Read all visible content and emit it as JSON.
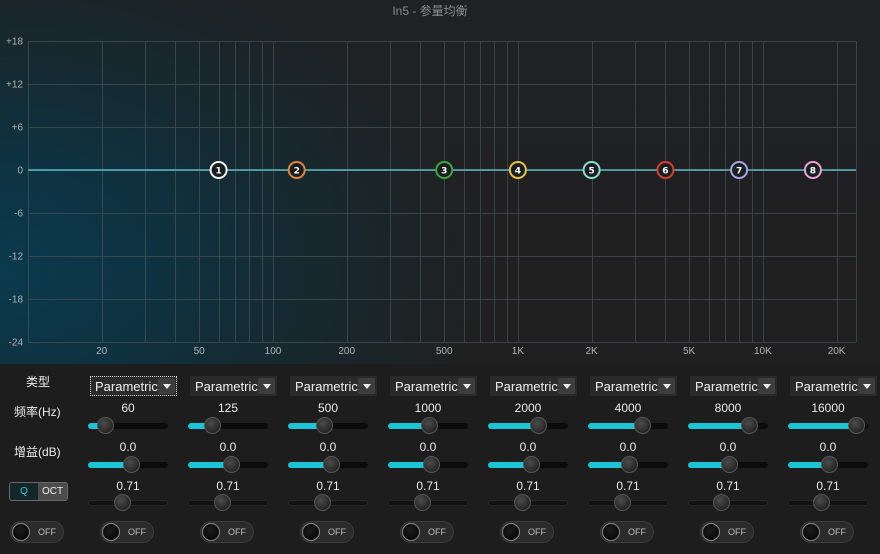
{
  "window": {
    "title": "In5 - 参量均衡"
  },
  "theme": {
    "background": "#1d1d1d",
    "accent": "#1bc5d5",
    "curve": "#5cb8c4",
    "node_fill": "#1a1e20"
  },
  "chart_data": {
    "type": "line",
    "x_scale": "log",
    "xlim": [
      10,
      24000
    ],
    "ylim": [
      -24,
      18
    ],
    "grid": true,
    "x_ticks": [
      {
        "value": 20,
        "label": "20"
      },
      {
        "value": 50,
        "label": "50"
      },
      {
        "value": 100,
        "label": "100"
      },
      {
        "value": 200,
        "label": "200"
      },
      {
        "value": 500,
        "label": "500"
      },
      {
        "value": 1000,
        "label": "1K"
      },
      {
        "value": 2000,
        "label": "2K"
      },
      {
        "value": 5000,
        "label": "5K"
      },
      {
        "value": 10000,
        "label": "10K"
      },
      {
        "value": 20000,
        "label": "20K"
      }
    ],
    "y_ticks": [
      {
        "value": 18,
        "label": "+18"
      },
      {
        "value": 12,
        "label": "+12"
      },
      {
        "value": 6,
        "label": "+6"
      },
      {
        "value": 0,
        "label": "0"
      },
      {
        "value": -6,
        "label": "-6"
      },
      {
        "value": -12,
        "label": "-12"
      },
      {
        "value": -18,
        "label": "-18"
      },
      {
        "value": -24,
        "label": "-24"
      }
    ],
    "series": [
      {
        "x": [
          10,
          24000
        ],
        "y": [
          0,
          0
        ]
      }
    ],
    "points": [
      {
        "label": "1",
        "x": 60,
        "y": 0,
        "color": "#f2f2f2"
      },
      {
        "label": "2",
        "x": 125,
        "y": 0,
        "color": "#e0873a"
      },
      {
        "label": "3",
        "x": 500,
        "y": 0,
        "color": "#3aa83a"
      },
      {
        "label": "4",
        "x": 1000,
        "y": 0,
        "color": "#e8c43c"
      },
      {
        "label": "5",
        "x": 2000,
        "y": 0,
        "color": "#8fe0c8"
      },
      {
        "label": "6",
        "x": 4000,
        "y": 0,
        "color": "#d8402c"
      },
      {
        "label": "7",
        "x": 8000,
        "y": 0,
        "color": "#a6a6e0"
      },
      {
        "label": "8",
        "x": 16000,
        "y": 0,
        "color": "#e8a2d4"
      }
    ]
  },
  "labels": {
    "type": "类型",
    "frequency": "频率(Hz)",
    "gain": "增益(dB)"
  },
  "mode_toggle": {
    "options": [
      {
        "label": "Q",
        "selected": true
      },
      {
        "label": "OCT",
        "selected": false
      }
    ]
  },
  "master_switch": {
    "label": "OFF",
    "on": false
  },
  "bands": [
    {
      "type": "Parametric",
      "freq": "60",
      "gain": "0.0",
      "q": "0.71",
      "freq_level": 0.14,
      "gain_level": 0.55,
      "q_level": 0.41,
      "switch_label": "OFF",
      "focused": true
    },
    {
      "type": "Parametric",
      "freq": "125",
      "gain": "0.0",
      "q": "0.71",
      "freq_level": 0.25,
      "gain_level": 0.55,
      "q_level": 0.41,
      "switch_label": "OFF"
    },
    {
      "type": "Parametric",
      "freq": "500",
      "gain": "0.0",
      "q": "0.71",
      "freq_level": 0.45,
      "gain_level": 0.55,
      "q_level": 0.41,
      "switch_label": "OFF"
    },
    {
      "type": "Parametric",
      "freq": "1000",
      "gain": "0.0",
      "q": "0.71",
      "freq_level": 0.53,
      "gain_level": 0.55,
      "q_level": 0.41,
      "switch_label": "OFF"
    },
    {
      "type": "Parametric",
      "freq": "2000",
      "gain": "0.0",
      "q": "0.71",
      "freq_level": 0.66,
      "gain_level": 0.55,
      "q_level": 0.41,
      "switch_label": "OFF"
    },
    {
      "type": "Parametric",
      "freq": "4000",
      "gain": "0.0",
      "q": "0.71",
      "freq_level": 0.73,
      "gain_level": 0.53,
      "q_level": 0.41,
      "switch_label": "OFF"
    },
    {
      "type": "Parametric",
      "freq": "8000",
      "gain": "0.0",
      "q": "0.71",
      "freq_level": 0.83,
      "gain_level": 0.53,
      "q_level": 0.4,
      "switch_label": "OFF"
    },
    {
      "type": "Parametric",
      "freq": "16000",
      "gain": "0.0",
      "q": "0.71",
      "freq_level": 0.94,
      "gain_level": 0.52,
      "q_level": 0.4,
      "switch_label": "OFF"
    }
  ]
}
